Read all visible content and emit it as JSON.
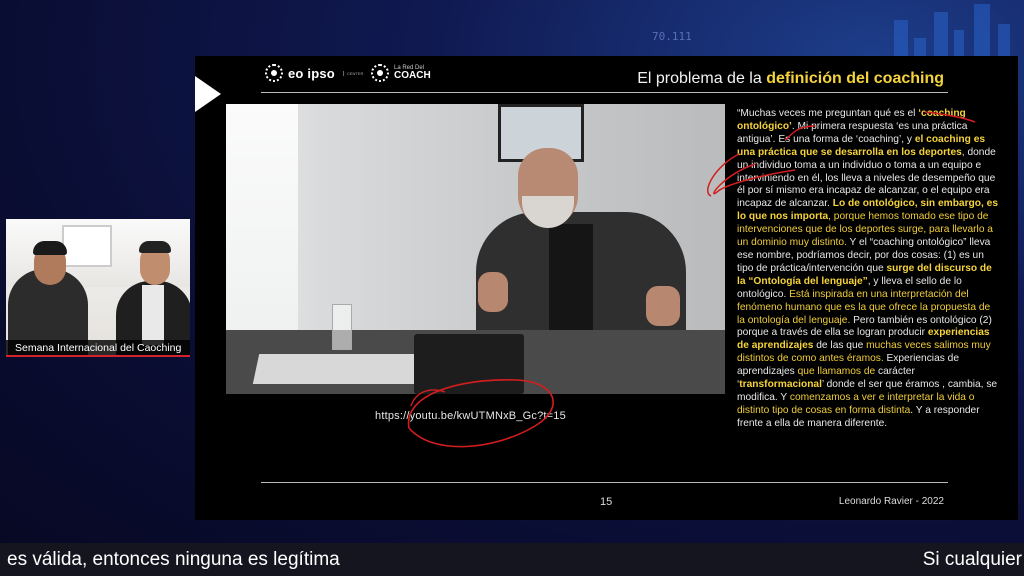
{
  "background": {
    "ticker_value": "70.111"
  },
  "slide": {
    "brand_eo": "eo ipso",
    "brand_eo_sub": "CENTER",
    "brand_coach_small": "La Red Del",
    "brand_coach_big": "COACH",
    "title_prefix": "El problema de la ",
    "title_highlight": "definición del coaching",
    "link": "https://youtu.be/kwUTMNxB_Gc?t=15",
    "quote": [
      {
        "t": "“Muchas veces me preguntan qué es el ",
        "s": ""
      },
      {
        "t": "‘coaching ontológico’",
        "s": "y"
      },
      {
        "t": ". Mi primera respuesta ‘es una práctica antigua’. Es una forma de ‘coaching’, y ",
        "s": ""
      },
      {
        "t": "el coaching es una práctica que se desarrolla en los deportes",
        "s": "y"
      },
      {
        "t": ", donde un individuo toma a un individuo o toma a un equipo e interviniendo en él, los lleva a niveles de desempeño que él por sí mismo era incapaz de alcanzar, o el equipo era incapaz de alcanzar. ",
        "s": ""
      },
      {
        "t": "Lo de ontológico, sin embargo, es lo que nos importa",
        "s": "y"
      },
      {
        "t": ", porque hemos tomado ese tipo de intervenciones que de los deportes surge, para llevarlo a un dominio muy distinto.",
        "s": "g"
      },
      {
        "t": " Y el “coaching ontológico” lleva ese nombre, podríamos decir, por dos cosas: (1) es un tipo de práctica/intervención que ",
        "s": ""
      },
      {
        "t": "surge del discurso de la “Ontología del lenguaje”",
        "s": "y"
      },
      {
        "t": ", y lleva el sello de lo ontológico. ",
        "s": ""
      },
      {
        "t": "Está inspirada en una interpretación del fenómeno humano que es la que ofrece la propuesta de la ontología del lenguaje.",
        "s": "g"
      },
      {
        "t": " Pero también es ontológico (2) porque a través de ella se logran producir ",
        "s": ""
      },
      {
        "t": "experiencias de aprendizajes",
        "s": "y"
      },
      {
        "t": " de las que ",
        "s": ""
      },
      {
        "t": "muchas veces salimos muy distintos de como antes éramos.",
        "s": "g"
      },
      {
        "t": " Experiencias de aprendizajes ",
        "s": ""
      },
      {
        "t": "que llamamos de",
        "s": "g"
      },
      {
        "t": " carácter ‘",
        "s": ""
      },
      {
        "t": "transformacional",
        "s": "y"
      },
      {
        "t": "’ donde el ser que éramos , cambia, se modifica. Y ",
        "s": ""
      },
      {
        "t": "comenzamos a ver e interpretar la vida o distinto tipo de cosas en forma distinta",
        "s": "g"
      },
      {
        "t": ". Y a responder frente a ella de manera diferente.",
        "s": ""
      }
    ],
    "page_number": "15",
    "author": "Leonardo Ravier - 2022"
  },
  "webcam": {
    "label": "Semana Internacional del Caoching"
  },
  "captions": {
    "left": "es válida, entonces ninguna es legítima",
    "right": "Si cualquier"
  },
  "colors": {
    "highlight": "#f5d33c",
    "annotation": "#d41e1e",
    "label_accent": "#d3222a"
  }
}
